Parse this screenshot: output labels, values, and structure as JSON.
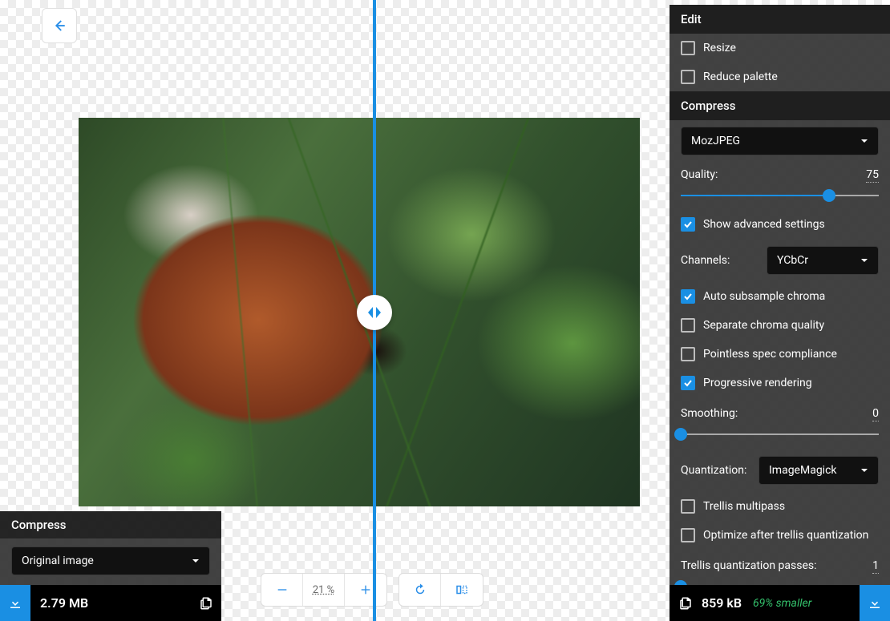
{
  "left": {
    "title": "Compress",
    "source_select": "Original image",
    "size": "2.79 MB"
  },
  "zoom": {
    "value": "21 %"
  },
  "sidebar": {
    "edit_title": "Edit",
    "resize": "Resize",
    "reduce_palette": "Reduce palette",
    "compress_title": "Compress",
    "encoder": "MozJPEG",
    "quality_label": "Quality:",
    "quality_value": "75",
    "show_advanced": "Show advanced settings",
    "channels_label": "Channels:",
    "channels_value": "YCbCr",
    "auto_subsample": "Auto subsample chroma",
    "separate_chroma": "Separate chroma quality",
    "pointless_spec": "Pointless spec compliance",
    "progressive": "Progressive rendering",
    "smoothing_label": "Smoothing:",
    "smoothing_value": "0",
    "quantization_label": "Quantization:",
    "quantization_value": "ImageMagick",
    "trellis_multipass": "Trellis multipass",
    "optimize_after_trellis": "Optimize after trellis quantization",
    "trellis_passes_label": "Trellis quantization passes:",
    "trellis_passes_value": "1"
  },
  "result": {
    "size": "859 kB",
    "savings": "69% smaller"
  }
}
